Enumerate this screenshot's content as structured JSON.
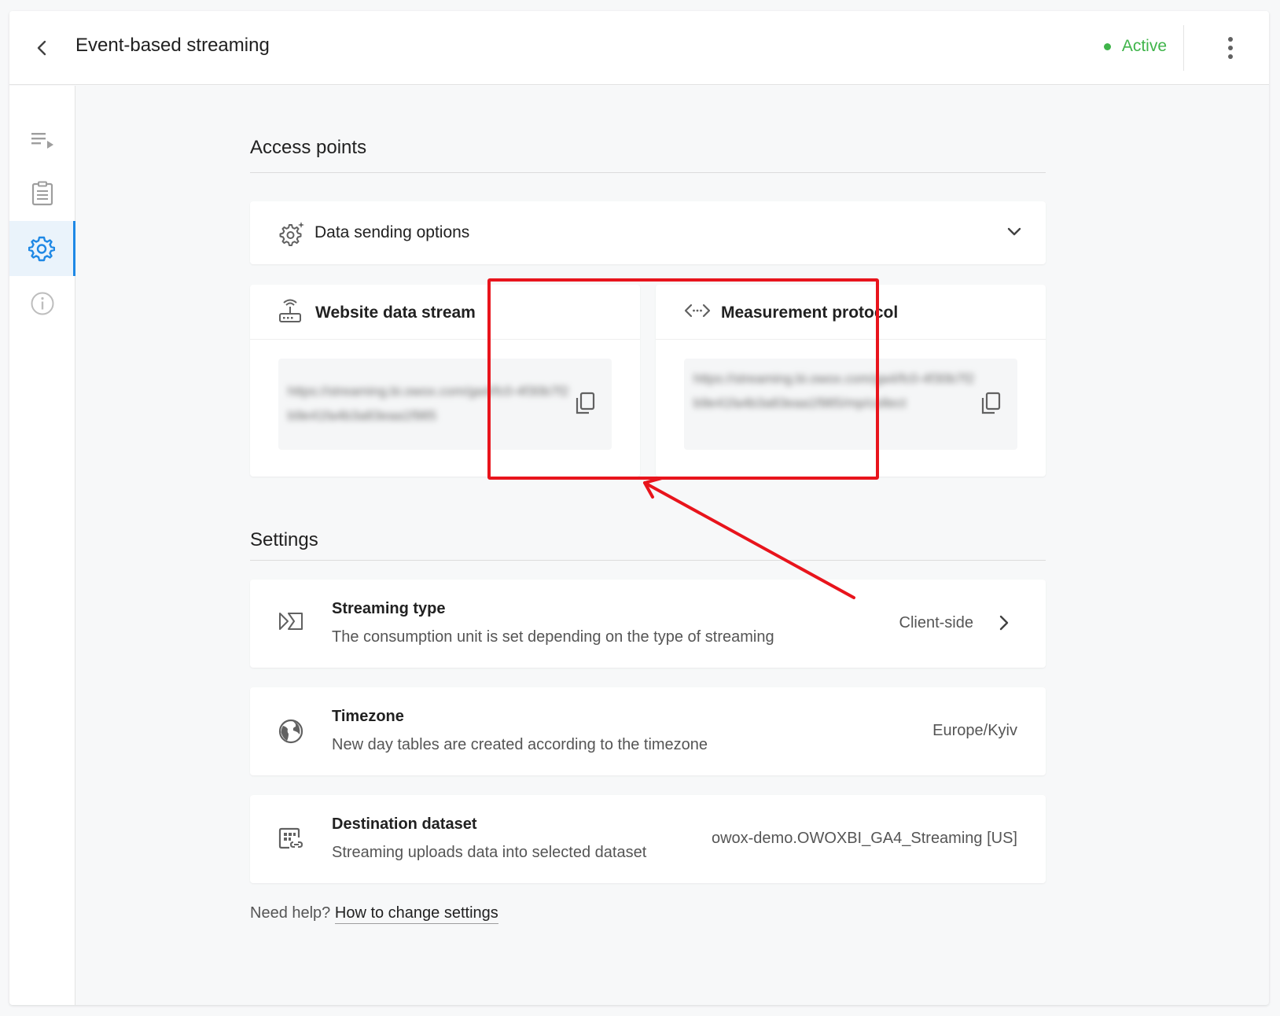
{
  "header": {
    "title": "Event-based streaming",
    "status": "Active",
    "status_color": "#3fb44a",
    "back_icon": "chevron-left-icon",
    "more_icon": "more-vert-icon"
  },
  "sidebar": {
    "items": [
      {
        "name": "playlist-icon",
        "active": false
      },
      {
        "name": "clipboard-icon",
        "active": false
      },
      {
        "name": "settings-gear-icon",
        "active": true
      },
      {
        "name": "info-icon",
        "active": false
      }
    ],
    "accent": "#1e88e5"
  },
  "access_points": {
    "title": "Access points",
    "data_sending_options": "Data sending options",
    "website_stream": {
      "title": "Website data stream",
      "url": "https://streaming.bi.owox.com/ga4/fc0-4f30b7f2b9e41fa4b3a83eaa1f985"
    },
    "measurement_protocol": {
      "title": "Measurement protocol",
      "url": "https://streaming.bi.owox.com/ga4/fc0-4f30b7f2b9e41fa4b3a83eaa1f985/mp/collect"
    }
  },
  "settings": {
    "title": "Settings",
    "rows": [
      {
        "title": "Streaming type",
        "description": "The consumption unit is set depending on the type of streaming",
        "value": "Client-side"
      },
      {
        "title": "Timezone",
        "description": "New day tables are created according to the timezone",
        "value": "Europe/Kyiv"
      },
      {
        "title": "Destination dataset",
        "description": "Streaming uploads data into selected dataset",
        "value": "owox-demo.OWOXBI_GA4_Streaming [US]"
      }
    ]
  },
  "help": {
    "prefix": "Need help?",
    "link": "How to change settings"
  },
  "annotation": {
    "color": "#e8141c"
  }
}
